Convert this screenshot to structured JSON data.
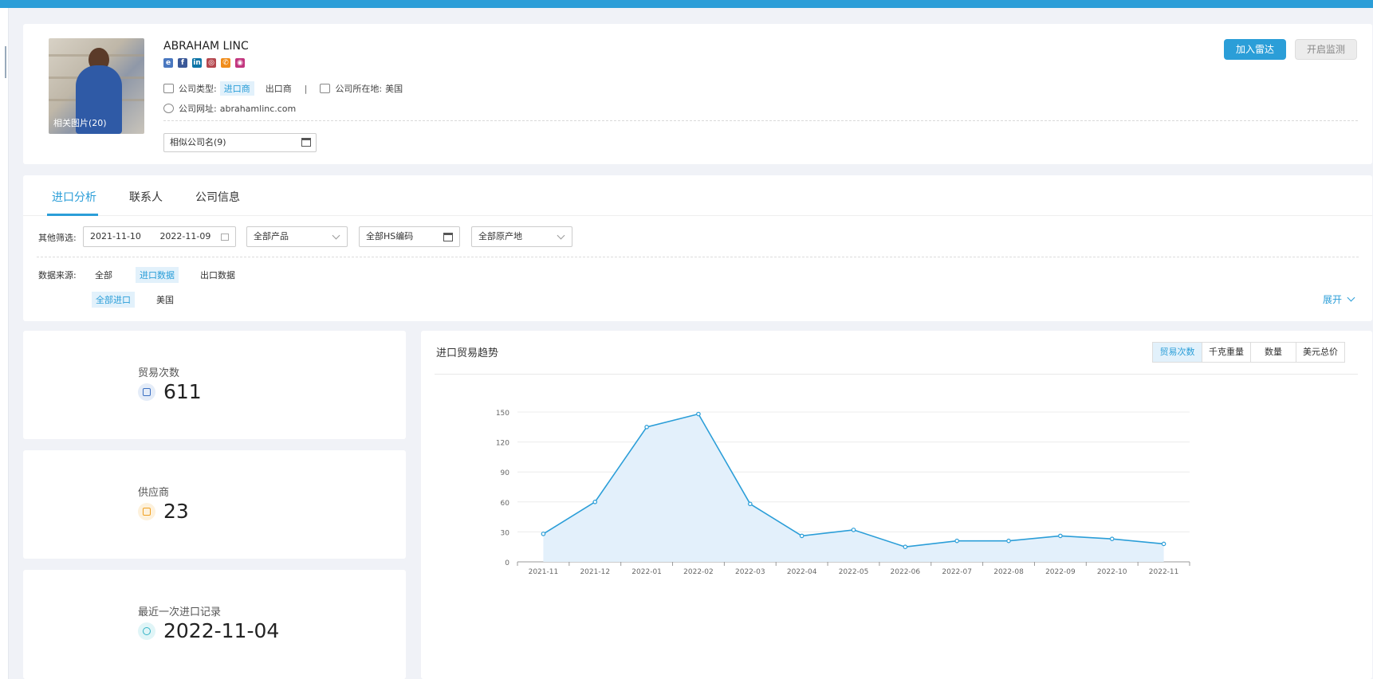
{
  "company": {
    "photo_caption": "相关图片(20)",
    "name": "ABRAHAM LINC",
    "socials": [
      {
        "icon": "ie-icon",
        "color": "#4a78c0",
        "glyph": "e"
      },
      {
        "icon": "facebook-icon",
        "color": "#3b5998",
        "glyph": "f"
      },
      {
        "icon": "linkedin-icon",
        "color": "#0e76a8",
        "glyph": "in"
      },
      {
        "icon": "directory-icon",
        "color": "#b5484f",
        "glyph": "◎"
      },
      {
        "icon": "phone-icon",
        "color": "#f08c1a",
        "glyph": "✆"
      },
      {
        "icon": "instagram-icon",
        "color": "#c2357e",
        "glyph": "◉"
      }
    ],
    "type_label": "公司类型:",
    "type_importer": "进口商",
    "type_exporter": "出口商",
    "divider": "|",
    "location_label": "公司所在地:",
    "location_value": "美国",
    "website_label": "公司网址:",
    "website_value": "abrahamlinc.com",
    "similar_names": "相似公司名(9)"
  },
  "actions": {
    "add_radar": "加入雷达",
    "start_monitor": "开启监测"
  },
  "tabs": [
    "进口分析",
    "联系人",
    "公司信息"
  ],
  "filters": {
    "other_label": "其他筛选:",
    "date_start": "2021-11-10",
    "date_end": "2022-11-09",
    "product": "全部产品",
    "hs_code": "全部HS编码",
    "origin": "全部原产地",
    "source_label": "数据来源:",
    "source_all": "全部",
    "source_import": "进口数据",
    "source_export": "出口数据",
    "scope_all_import": "全部进口",
    "scope_us": "美国",
    "expand": "展开"
  },
  "stats": {
    "trades_label": "贸易次数",
    "trades_value": "611",
    "suppliers_label": "供应商",
    "suppliers_value": "23",
    "last_import_label": "最近一次进口记录",
    "last_import_value": "2022-11-04",
    "colors": {
      "trades": "#3a6fc2",
      "suppliers": "#f0a020",
      "last": "#33b3c6"
    }
  },
  "chart_header": {
    "title": "进口贸易趋势",
    "metrics": [
      "贸易次数",
      "千克重量",
      "数量",
      "美元总价"
    ],
    "active_metric": 0
  },
  "chart_data": {
    "type": "area",
    "categories": [
      "2021-11",
      "2021-12",
      "2022-01",
      "2022-02",
      "2022-03",
      "2022-04",
      "2022-05",
      "2022-06",
      "2022-07",
      "2022-08",
      "2022-09",
      "2022-10",
      "2022-11"
    ],
    "values": [
      28,
      60,
      135,
      148,
      58,
      26,
      32,
      15,
      21,
      21,
      26,
      23,
      18
    ],
    "yticks": [
      0,
      30,
      60,
      90,
      120,
      150
    ],
    "ylim": [
      0,
      150
    ],
    "grid": true,
    "line_color": "#2b9ed8",
    "fill_color": "#e3f0fb"
  }
}
